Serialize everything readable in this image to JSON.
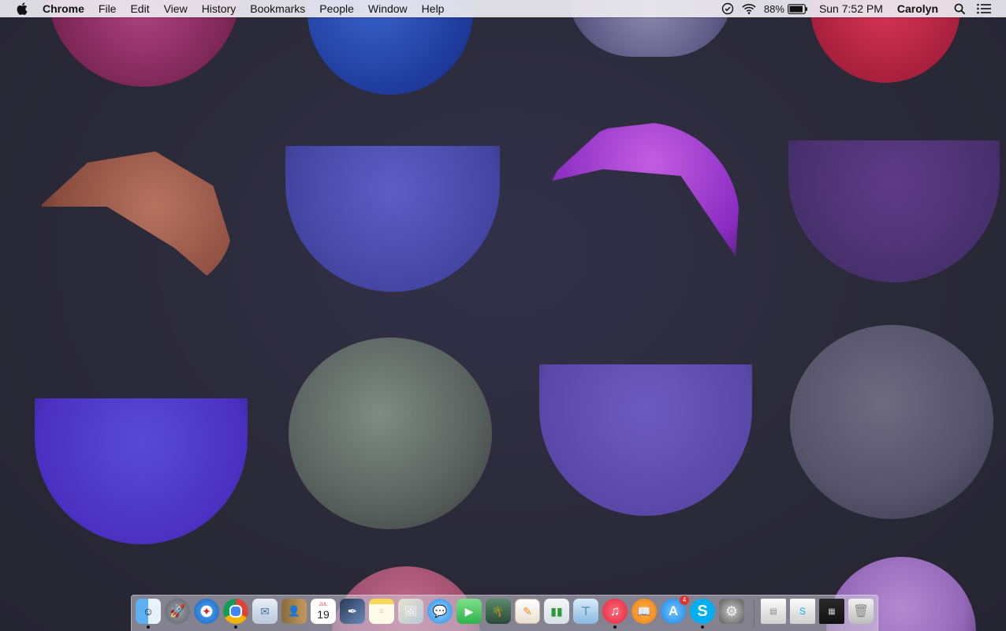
{
  "menubar": {
    "app_name": "Chrome",
    "menus": [
      "File",
      "Edit",
      "View",
      "History",
      "Bookmarks",
      "People",
      "Window",
      "Help"
    ],
    "status": {
      "battery_percent": "88%",
      "clock": "Sun 7:52 PM",
      "user": "Carolyn"
    }
  },
  "dock": {
    "items": [
      {
        "name": "finder",
        "running": true
      },
      {
        "name": "launchpad",
        "running": false
      },
      {
        "name": "safari",
        "running": false
      },
      {
        "name": "chrome",
        "running": true
      },
      {
        "name": "mail",
        "running": false
      },
      {
        "name": "contacts",
        "running": false
      },
      {
        "name": "calendar",
        "running": false,
        "month": "JUL",
        "day": "19"
      },
      {
        "name": "pages-pen",
        "running": false
      },
      {
        "name": "notes",
        "running": false
      },
      {
        "name": "photo-browser",
        "running": false
      },
      {
        "name": "messages",
        "running": false
      },
      {
        "name": "facetime",
        "running": false
      },
      {
        "name": "photo-booth",
        "running": false
      },
      {
        "name": "pages",
        "running": false
      },
      {
        "name": "numbers",
        "running": false
      },
      {
        "name": "keynote",
        "running": false
      },
      {
        "name": "itunes",
        "running": true
      },
      {
        "name": "ibooks",
        "running": false
      },
      {
        "name": "app-store",
        "running": false,
        "badge": "4"
      },
      {
        "name": "skype",
        "running": true
      },
      {
        "name": "system-preferences",
        "running": false
      }
    ],
    "minimized": [
      "itunes-window",
      "skype-window",
      "chrome-window"
    ],
    "trash": "trash"
  }
}
